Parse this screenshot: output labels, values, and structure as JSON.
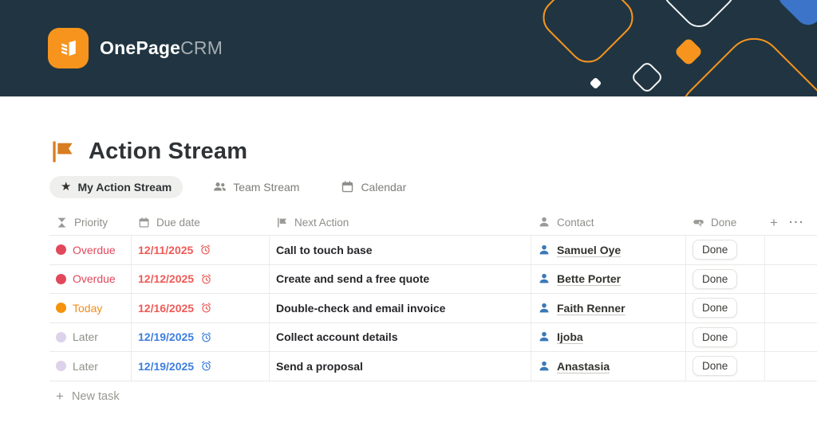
{
  "colors": {
    "header_bg": "#203541",
    "brand_orange": "#f7941e",
    "shape_blue": "#3b74c8",
    "overdue": "#e2485c",
    "today_dot": "#f5920e",
    "today_text": "#ef8c21",
    "later_dot": "#dcd2e9",
    "later_text": "#908f8b",
    "overdue_date": "#ed5b57",
    "future_date": "#3c7ede",
    "contact_blue": "#3a79b8",
    "flag_orange": "#d87d20"
  },
  "header": {
    "logo_bold": "OnePage",
    "logo_light": "CRM"
  },
  "page": {
    "title": "Action Stream",
    "new_task": "New task",
    "new_task_plus": "+",
    "add_column": "+",
    "more": "···"
  },
  "tabs": [
    {
      "icon": "star-icon",
      "label": "My Action Stream",
      "active": true
    },
    {
      "icon": "team-icon",
      "label": "Team Stream",
      "active": false
    },
    {
      "icon": "calendar-icon",
      "label": "Calendar",
      "active": false
    }
  ],
  "table": {
    "columns": [
      {
        "icon": "hourglass-icon",
        "label": "Priority"
      },
      {
        "icon": "calendar-icon",
        "label": "Due date"
      },
      {
        "icon": "flag-icon",
        "label": "Next Action"
      },
      {
        "icon": "person-icon",
        "label": "Contact"
      },
      {
        "icon": "button-click-icon",
        "label": "Done"
      }
    ],
    "rows": [
      {
        "priority": "Overdue",
        "priority_color": "#e2485c",
        "priority_text_color": "#e2485c",
        "due": "12/11/2025",
        "due_color": "#ed5b57",
        "action": "Call to touch base",
        "contact": "Samuel Oye",
        "done": "Done"
      },
      {
        "priority": "Overdue",
        "priority_color": "#e2485c",
        "priority_text_color": "#e2485c",
        "due": "12/12/2025",
        "due_color": "#ed5b57",
        "action": "Create and send a free quote",
        "contact": "Bette Porter",
        "done": "Done"
      },
      {
        "priority": "Today",
        "priority_color": "#f5920e",
        "priority_text_color": "#ef8c21",
        "due": "12/16/2025",
        "due_color": "#ed5b57",
        "action": "Double-check and email invoice",
        "contact": "Faith Renner",
        "done": "Done"
      },
      {
        "priority": "Later",
        "priority_color": "#dcd2e9",
        "priority_text_color": "#908f8b",
        "due": "12/19/2025",
        "due_color": "#3c7ede",
        "action": "Collect account details",
        "contact": "Ijoba",
        "done": "Done"
      },
      {
        "priority": "Later",
        "priority_color": "#dcd2e9",
        "priority_text_color": "#908f8b",
        "due": "12/19/2025",
        "due_color": "#3c7ede",
        "action": "Send a proposal",
        "contact": "Anastasia",
        "done": "Done"
      }
    ]
  }
}
